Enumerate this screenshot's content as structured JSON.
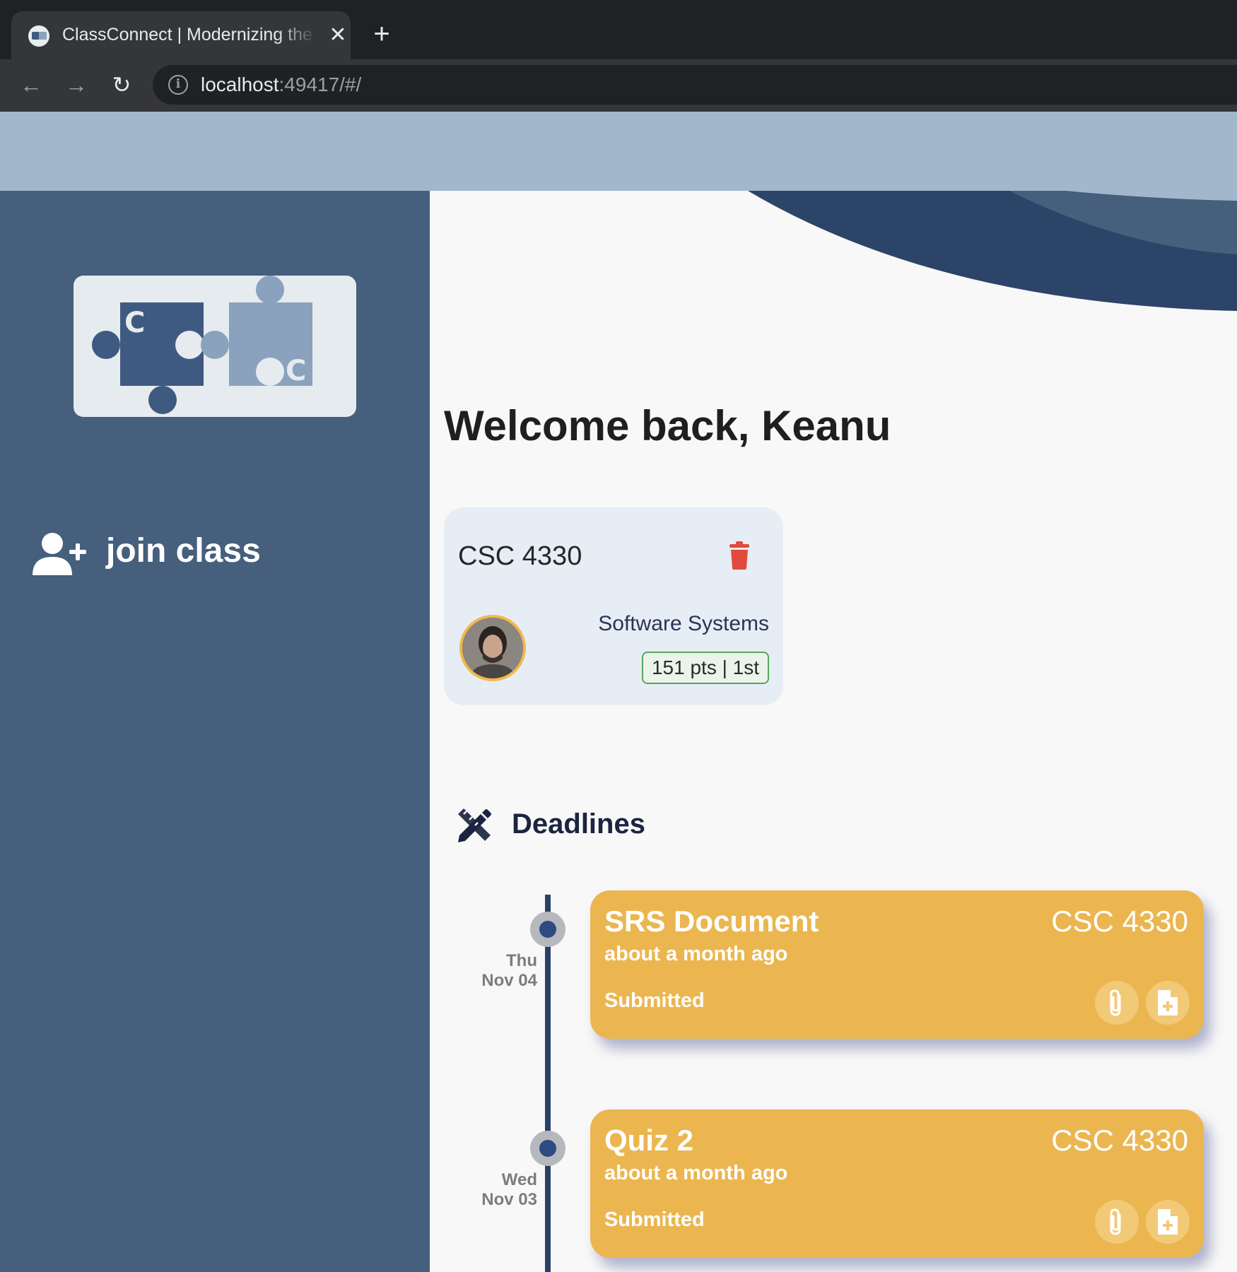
{
  "browser": {
    "tab_title": "ClassConnect | Modernizing the Classroom",
    "close_glyph": "✕",
    "new_tab_glyph": "+",
    "back_glyph": "←",
    "forward_glyph": "→",
    "reload_glyph": "↻",
    "url_host": "localhost",
    "url_rest": ":49417/#/"
  },
  "sidebar": {
    "join_label": "join class",
    "join_icon": "user-plus-icon"
  },
  "main": {
    "welcome": "Welcome back, Keanu",
    "class_card": {
      "code": "CSC 4330",
      "name": "Software Systems",
      "points": "151 pts | 1st",
      "delete_icon": "trash-icon",
      "avatar": "instructor-avatar"
    },
    "deadlines": {
      "title": "Deadlines",
      "icon": "pencil-ruler-icon",
      "items": [
        {
          "title": "SRS Document",
          "course": "CSC 4330",
          "time": "about a month ago",
          "status": "Submitted",
          "day": "Thu",
          "date": "Nov 04"
        },
        {
          "title": "Quiz 2",
          "course": "CSC 4330",
          "time": "about a month ago",
          "status": "Submitted",
          "day": "Wed",
          "date": "Nov 03"
        }
      ]
    }
  },
  "colors": {
    "header": "#a2b7cc",
    "sidebar": "#455f7d",
    "wave_dark": "#2c4468",
    "deadline_card": "#ebb650",
    "trash": "#e04b3d",
    "badge_border": "#57a65c"
  }
}
